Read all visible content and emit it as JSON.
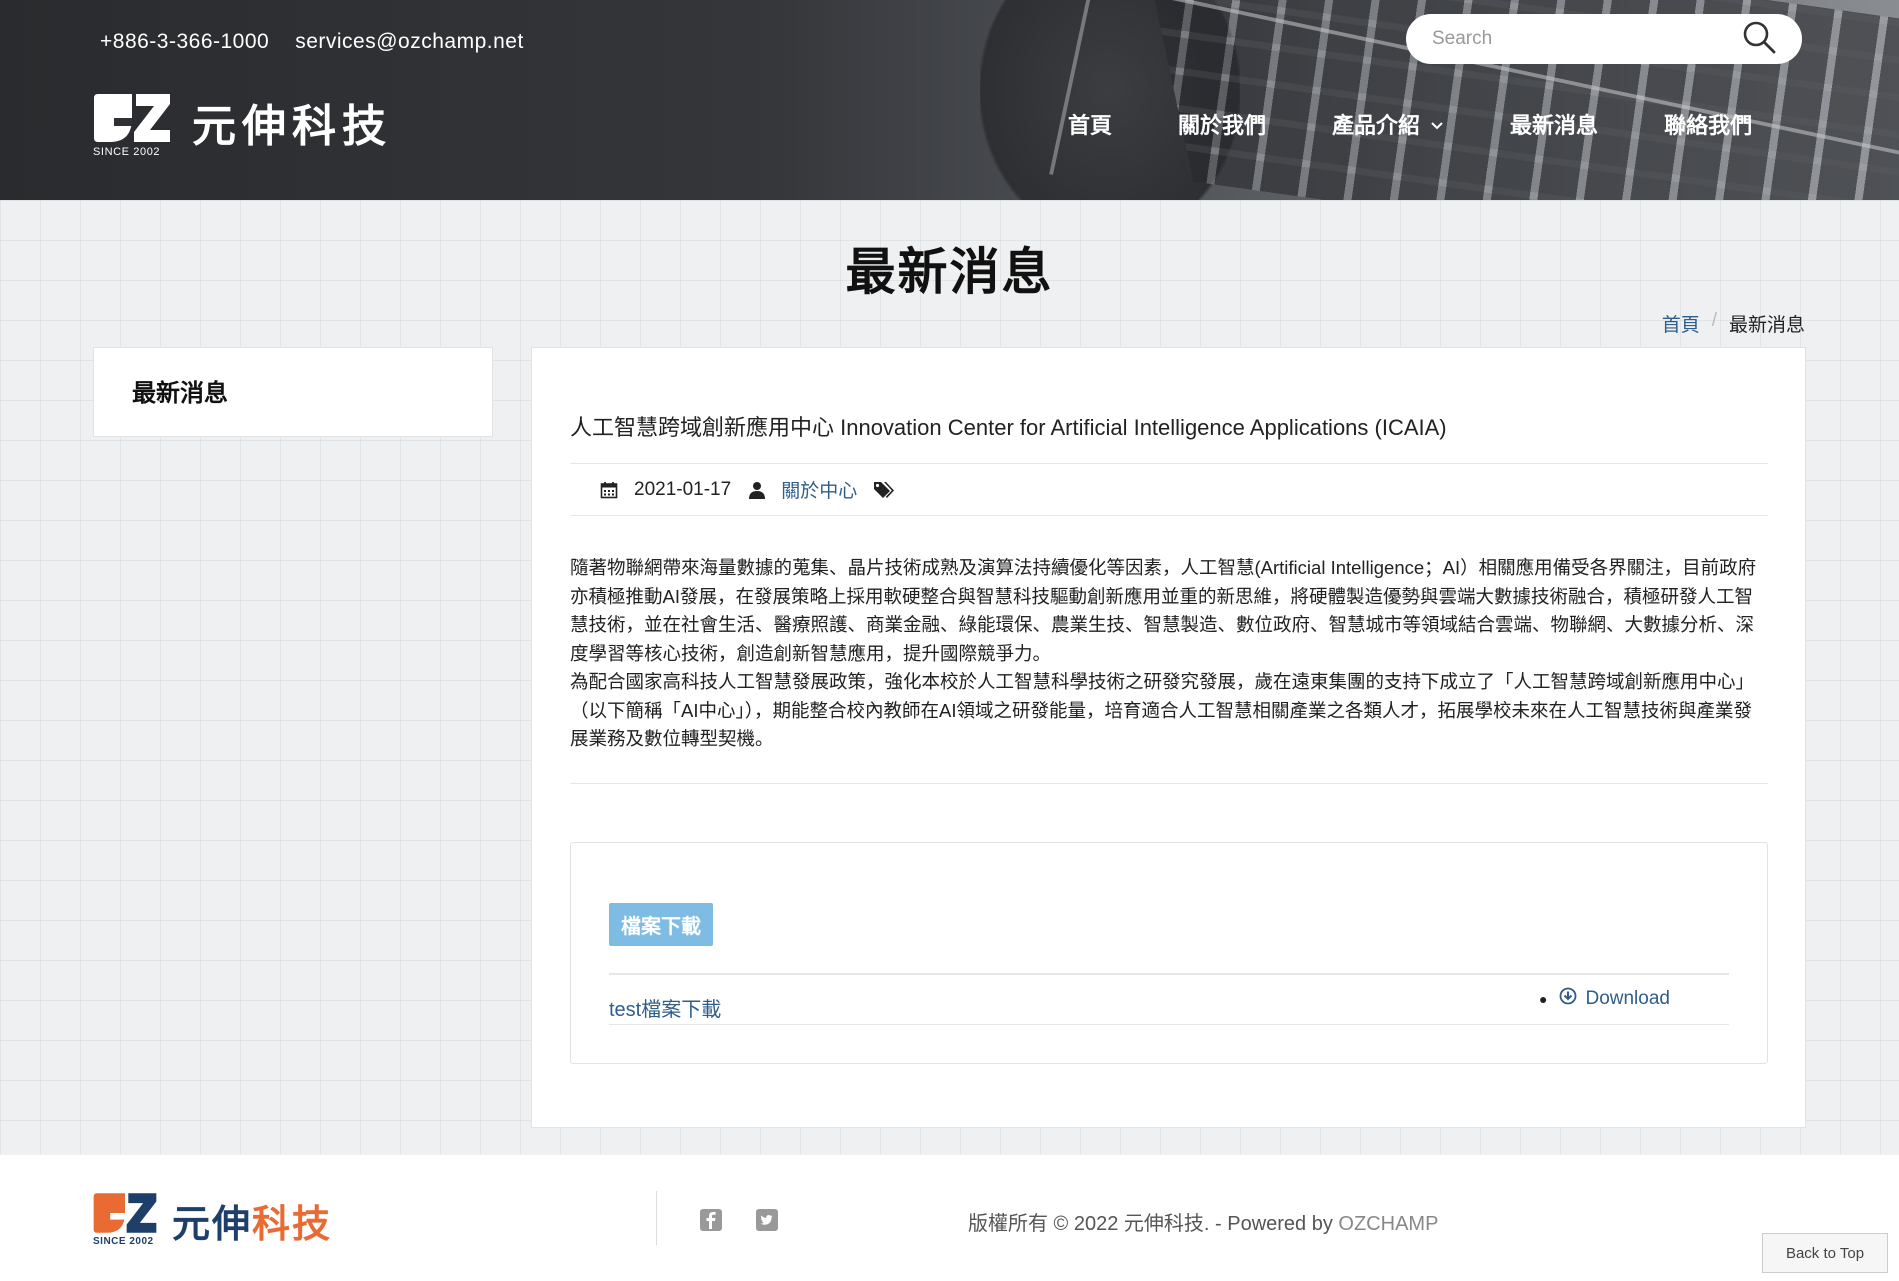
{
  "header": {
    "phone": "+886-3-366-1000",
    "email": "services@ozchamp.net",
    "logo_since": "SINCE 2002",
    "logo_text": "元伸科技",
    "search_placeholder": "Search",
    "nav": [
      {
        "label": "首頁"
      },
      {
        "label": "關於我們"
      },
      {
        "label": "產品介紹"
      },
      {
        "label": "最新消息"
      },
      {
        "label": "聯絡我們"
      }
    ]
  },
  "page": {
    "title": "最新消息",
    "breadcrumb": {
      "home": "首頁",
      "sep": "/",
      "current": "最新消息"
    }
  },
  "sidebar": {
    "title": "最新消息"
  },
  "article": {
    "title": "人工智慧跨域創新應用中心 Innovation Center for Artificial Intelligence Applications (ICAIA)",
    "date": "2021-01-17",
    "author": "關於中心",
    "paragraph1": "隨著物聯網帶來海量數據的蒐集、晶片技術成熟及演算法持續優化等因素，人工智慧(Artificial Intelligence；AI）相關應用備受各界關注，目前政府亦積極推動AI發展，在發展策略上採用軟硬整合與智慧科技驅動創新應用並重的新思維，將硬體製造優勢與雲端大數據技術融合，積極研發人工智慧技術，並在社會生活、醫療照護、商業金融、綠能環保、農業生技、智慧製造、數位政府、智慧城市等領域結合雲端、物聯網、大數據分析、深度學習等核心技術，創造創新智慧應用，提升國際競爭力。",
    "paragraph2": "為配合國家高科技人工智慧發展政策，強化本校於人工智慧科學技術之研發究發展，歲在遠東集團的支持下成立了「人工智慧跨域創新應用中心」（以下簡稱「AI中心」），期能整合校內教師在AI領域之研發能量，培育適合人工智慧相關產業之各類人才，拓展學校未來在人工智慧技術與產業發展業務及數位轉型契機。"
  },
  "downloads": {
    "badge": "檔案下載",
    "items": [
      {
        "name": "test檔案下載",
        "link": "Download"
      }
    ]
  },
  "footer": {
    "logo_since": "SINCE 2002",
    "logo_text_a": "元伸",
    "logo_text_b": "科技",
    "copyright": "版權所有 © 2022 元伸科技. - Powered by ",
    "powered_brand": "OZCHAMP",
    "back_to_top": "Back to Top"
  },
  "colors": {
    "link": "#2f5e8c",
    "badge": "#7fbce3",
    "brand_orange": "#e96a33",
    "brand_navy": "#1f3f6b"
  }
}
